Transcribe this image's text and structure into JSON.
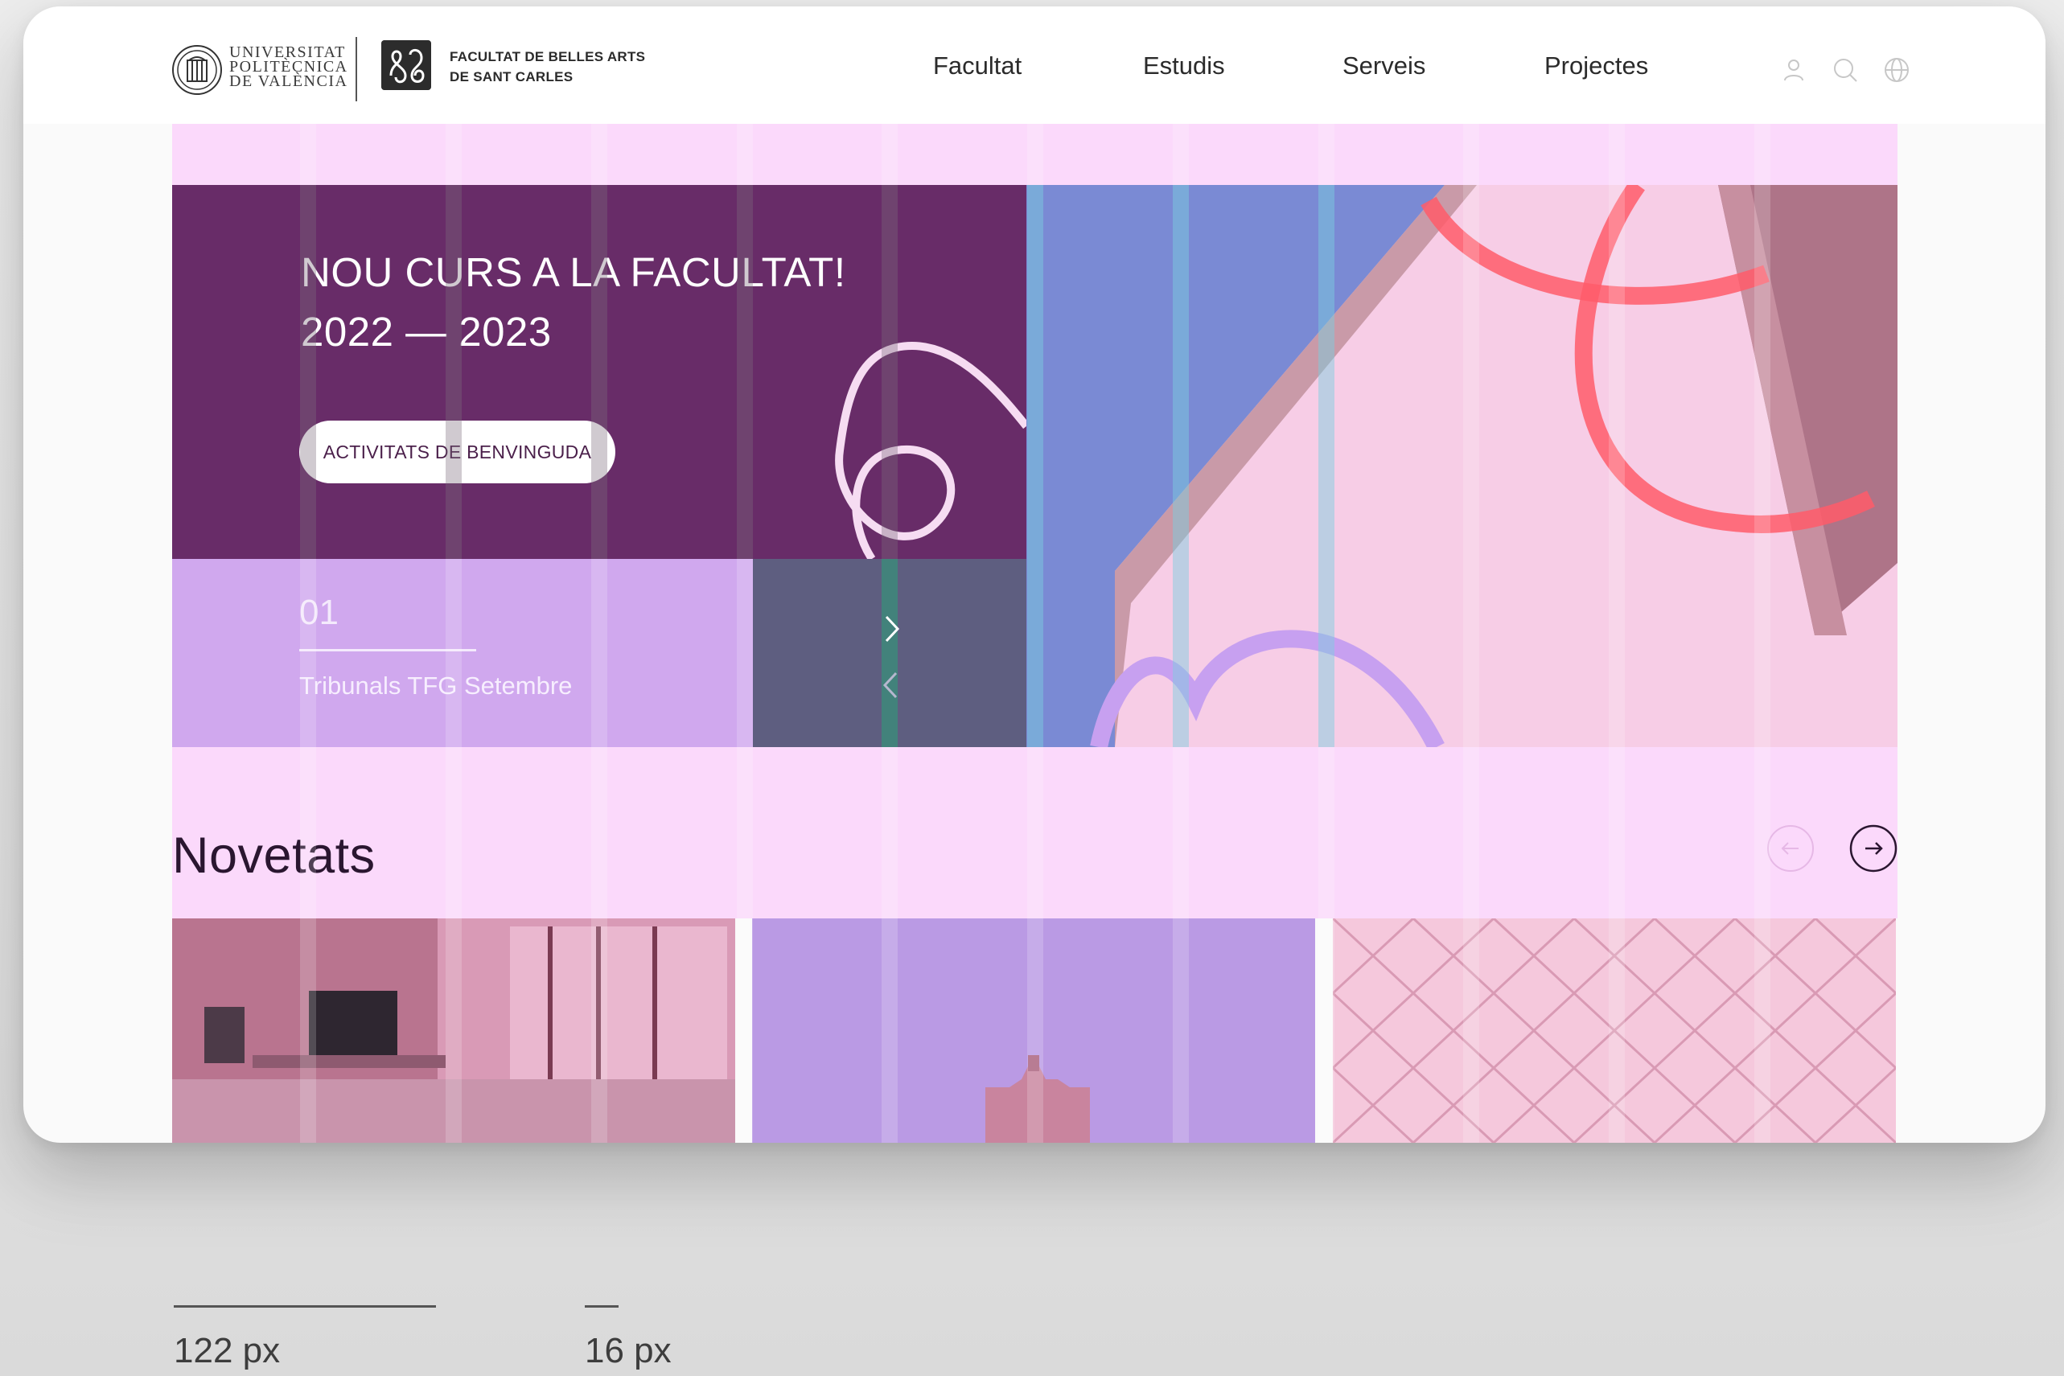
{
  "header": {
    "university_name": "UNIVERSITAT\nPOLITÈCNICA\nDE VALÈNCIA",
    "faculty_name_line1": "FACULTAT DE BELLES ARTS",
    "faculty_name_line2": "DE SANT CARLES",
    "nav": [
      {
        "label": "Facultat"
      },
      {
        "label": "Estudis"
      },
      {
        "label": "Serveis"
      },
      {
        "label": "Projectes"
      }
    ],
    "icons": [
      "user-icon",
      "search-icon",
      "globe-icon"
    ]
  },
  "hero": {
    "title_line1": "NOU CURS A LA FACULTAT!",
    "title_line2": "2022 — 2023",
    "button_label": "ACTIVITATS DE BENVINGUDA",
    "slide_number": "01",
    "slide_caption": "Tribunals TFG Setembre",
    "next_icon": "chevron-right-icon",
    "prev_icon": "chevron-left-icon"
  },
  "news": {
    "title": "Novetats",
    "prev_icon": "arrow-left-icon",
    "next_icon": "arrow-right-icon",
    "cards": [
      {
        "image": "studio-workspace-photo"
      },
      {
        "image": "building-tower-photo"
      },
      {
        "image": "glass-ceiling-grid-photo"
      }
    ]
  },
  "annotations": {
    "column_width": "122 px",
    "gutter_width": "16 px"
  },
  "colors": {
    "grid_overlay": "#fbd9fb",
    "hero_purple": "#682c68",
    "slide_lilac": "#d0a8ee",
    "control_slate": "#5e5e80",
    "accent_teal": "#19675e"
  }
}
